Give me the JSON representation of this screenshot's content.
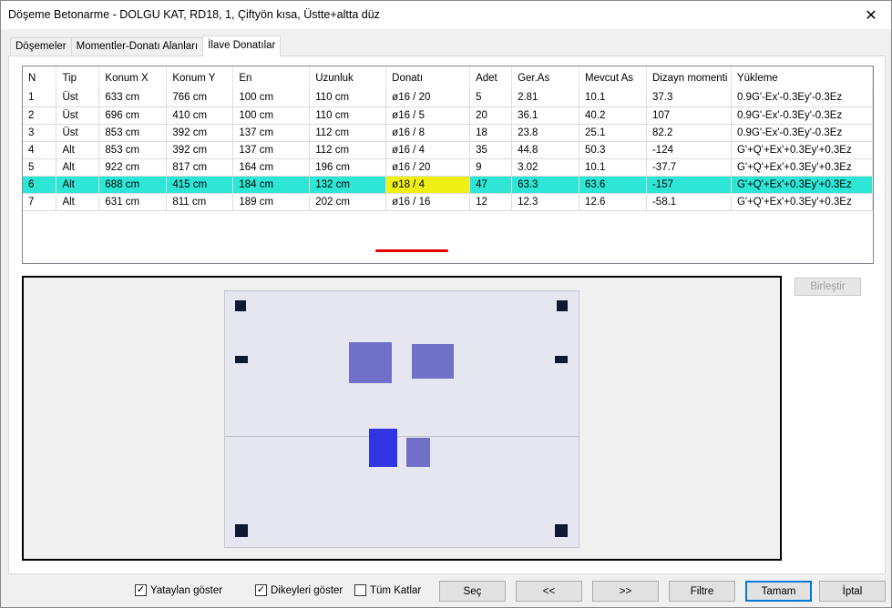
{
  "window": {
    "title": "Döşeme Betonarme - DOLGU KAT, RD18, 1, Çiftyön kısa, Üstte+altta düz",
    "close_glyph": "✕"
  },
  "tabs": [
    {
      "label": "Döşemeler",
      "active": false
    },
    {
      "label": "Momentler-Donatı Alanları",
      "active": false
    },
    {
      "label": "İlave Donatılar",
      "active": true
    }
  ],
  "table": {
    "columns": [
      "N",
      "Tip",
      "Konum X",
      "Konum Y",
      "En",
      "Uzunluk",
      "Donatı",
      "Adet",
      "Ger.As",
      "Mevcut As",
      "Dizayn momenti",
      "Yükleme"
    ],
    "rows": [
      [
        "1",
        "Üst",
        "633 cm",
        "766 cm",
        "100 cm",
        "110 cm",
        "ø16 / 20",
        "5",
        "2.81",
        "10.1",
        "37.3",
        "0.9G'-Ex'-0.3Ey'-0.3Ez"
      ],
      [
        "2",
        "Üst",
        "696 cm",
        "410 cm",
        "100 cm",
        "110 cm",
        "ø16 / 5",
        "20",
        "36.1",
        "40.2",
        "107",
        "0.9G'-Ex'-0.3Ey'-0.3Ez"
      ],
      [
        "3",
        "Üst",
        "853 cm",
        "392 cm",
        "137 cm",
        "112 cm",
        "ø16 / 8",
        "18",
        "23.8",
        "25.1",
        "82.2",
        "0.9G'-Ex'-0.3Ey'-0.3Ez"
      ],
      [
        "4",
        "Alt",
        "853 cm",
        "392 cm",
        "137 cm",
        "112 cm",
        "ø16 / 4",
        "35",
        "44.8",
        "50.3",
        "-124",
        "G'+Q'+Ex'+0.3Ey'+0.3Ez"
      ],
      [
        "5",
        "Alt",
        "922 cm",
        "817 cm",
        "164 cm",
        "196 cm",
        "ø16 / 20",
        "9",
        "3.02",
        "10.1",
        "-37.7",
        "G'+Q'+Ex'+0.3Ey'+0.3Ez"
      ],
      [
        "6",
        "Alt",
        "688 cm",
        "415 cm",
        "184 cm",
        "132 cm",
        "ø18 / 4",
        "47",
        "63.3",
        "63.6",
        "-157",
        "G'+Q'+Ex'+0.3Ey'+0.3Ez"
      ],
      [
        "7",
        "Alt",
        "631 cm",
        "811 cm",
        "189 cm",
        "202 cm",
        "ø16 / 16",
        "12",
        "12.3",
        "12.6",
        "-58.1",
        "G'+Q'+Ex'+0.3Ey'+0.3Ez"
      ]
    ],
    "selected_row": 5,
    "highlight_col": 6
  },
  "buttons": {
    "birlestir": "Birleştir",
    "sec": "Seç",
    "prev": "<<",
    "next": ">>",
    "filtre": "Filtre",
    "tamam": "Tamam",
    "iptal": "İptal"
  },
  "checkboxes": [
    {
      "label": "Yataylan göster",
      "checked": true
    },
    {
      "label": "Dikeyleri göster",
      "checked": true
    },
    {
      "label": "Tüm Katlar",
      "checked": false
    }
  ],
  "colors": {
    "selected_row": "#2ee6d6",
    "highlight_cell": "#f0f014",
    "rebar": "#7070c8",
    "rebar_selected": "#2f35e0",
    "column": "#0d1a33"
  }
}
